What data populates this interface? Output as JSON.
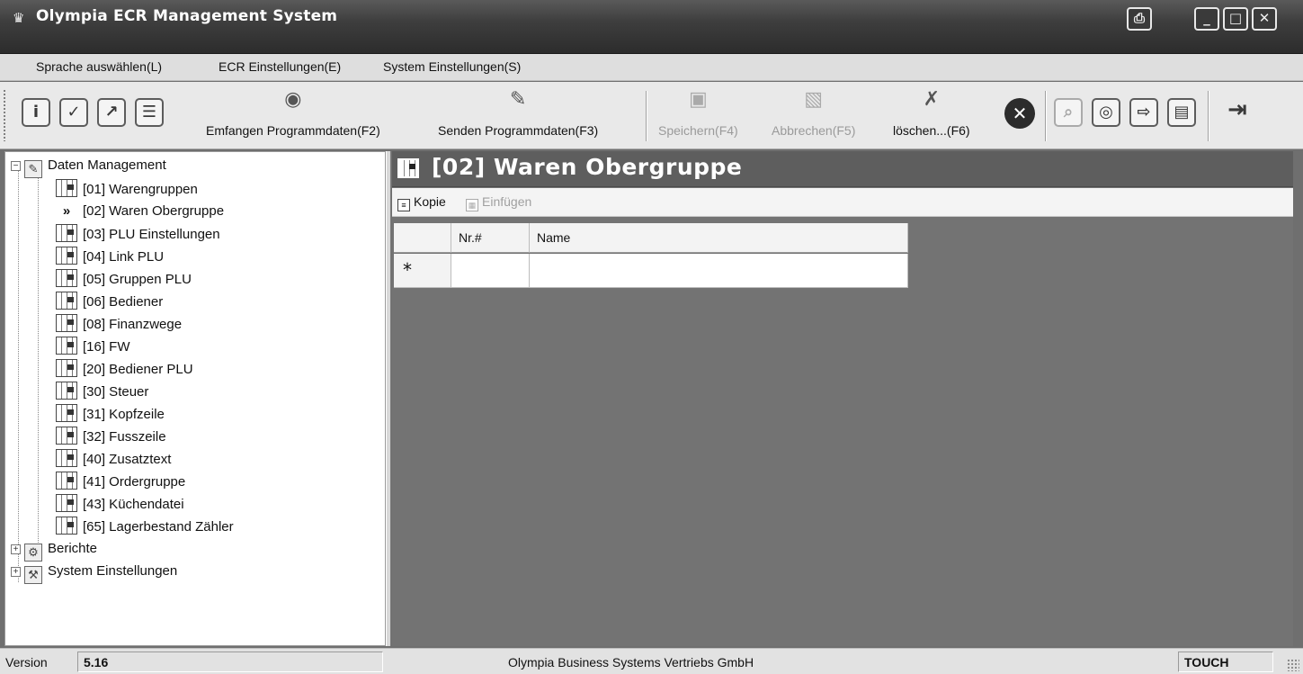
{
  "window": {
    "title": "Olympia ECR Management System",
    "print_icon": "printer-icon",
    "minimize_icon": "minimize-icon",
    "maximize_icon": "maximize-icon",
    "close_icon": "close-icon"
  },
  "menu": [
    {
      "label": "Sprache auswählen(L)"
    },
    {
      "label": "ECR Einstellungen(E)"
    },
    {
      "label": "System Einstellungen(S)"
    }
  ],
  "toolbar": {
    "small_icons_left": [
      "info-icon",
      "check-doc-icon",
      "chart-icon",
      "list-icon"
    ],
    "receive": {
      "label": "Emfangen Programmdaten(F2)",
      "icon": "globe-receive-icon"
    },
    "send": {
      "label": "Senden Programmdaten(F3)",
      "icon": "send-icon"
    },
    "save": {
      "label": "Speichern(F4)",
      "icon": "floppy-icon"
    },
    "cancel": {
      "label": "Abbrechen(F5)",
      "icon": "cancel-doc-icon"
    },
    "delete": {
      "label": "löschen...(F6)",
      "icon": "delete-doc-icon"
    },
    "x_icon": "close-circle-icon",
    "small_icons_right": [
      "search-doc-icon",
      "disk-icon",
      "export-icon",
      "form-icon"
    ],
    "exit_icon": "exit-door-icon"
  },
  "tree": {
    "root": {
      "label": "Daten Management"
    },
    "items": [
      {
        "label": "[01] Warengruppen"
      },
      {
        "label": "[02] Waren Obergruppe",
        "selected": true
      },
      {
        "label": "[03] PLU Einstellungen"
      },
      {
        "label": "[04] Link PLU"
      },
      {
        "label": "[05] Gruppen PLU"
      },
      {
        "label": "[06] Bediener"
      },
      {
        "label": "[08] Finanzwege"
      },
      {
        "label": "[16] FW"
      },
      {
        "label": "[20] Bediener PLU"
      },
      {
        "label": "[30] Steuer"
      },
      {
        "label": "[31] Kopfzeile"
      },
      {
        "label": "[32] Fusszeile"
      },
      {
        "label": "[40] Zusatztext"
      },
      {
        "label": "[41] Ordergruppe"
      },
      {
        "label": "[43] Küchendatei"
      },
      {
        "label": "[65] Lagerbestand Zähler"
      }
    ],
    "groups": [
      {
        "label": "Berichte"
      },
      {
        "label": "System Einstellungen"
      }
    ],
    "selected_marker": "»"
  },
  "content": {
    "title": "[02] Waren Obergruppe",
    "copy_label": "Kopie",
    "paste_label": "Einfügen",
    "grid": {
      "columns": [
        "Nr.#",
        "Name"
      ],
      "new_row_marker": "*"
    }
  },
  "status": {
    "version_label": "Version",
    "version_value": "5.16",
    "company": "Olympia Business Systems Vertriebs GmbH",
    "mode": "TOUCH"
  }
}
